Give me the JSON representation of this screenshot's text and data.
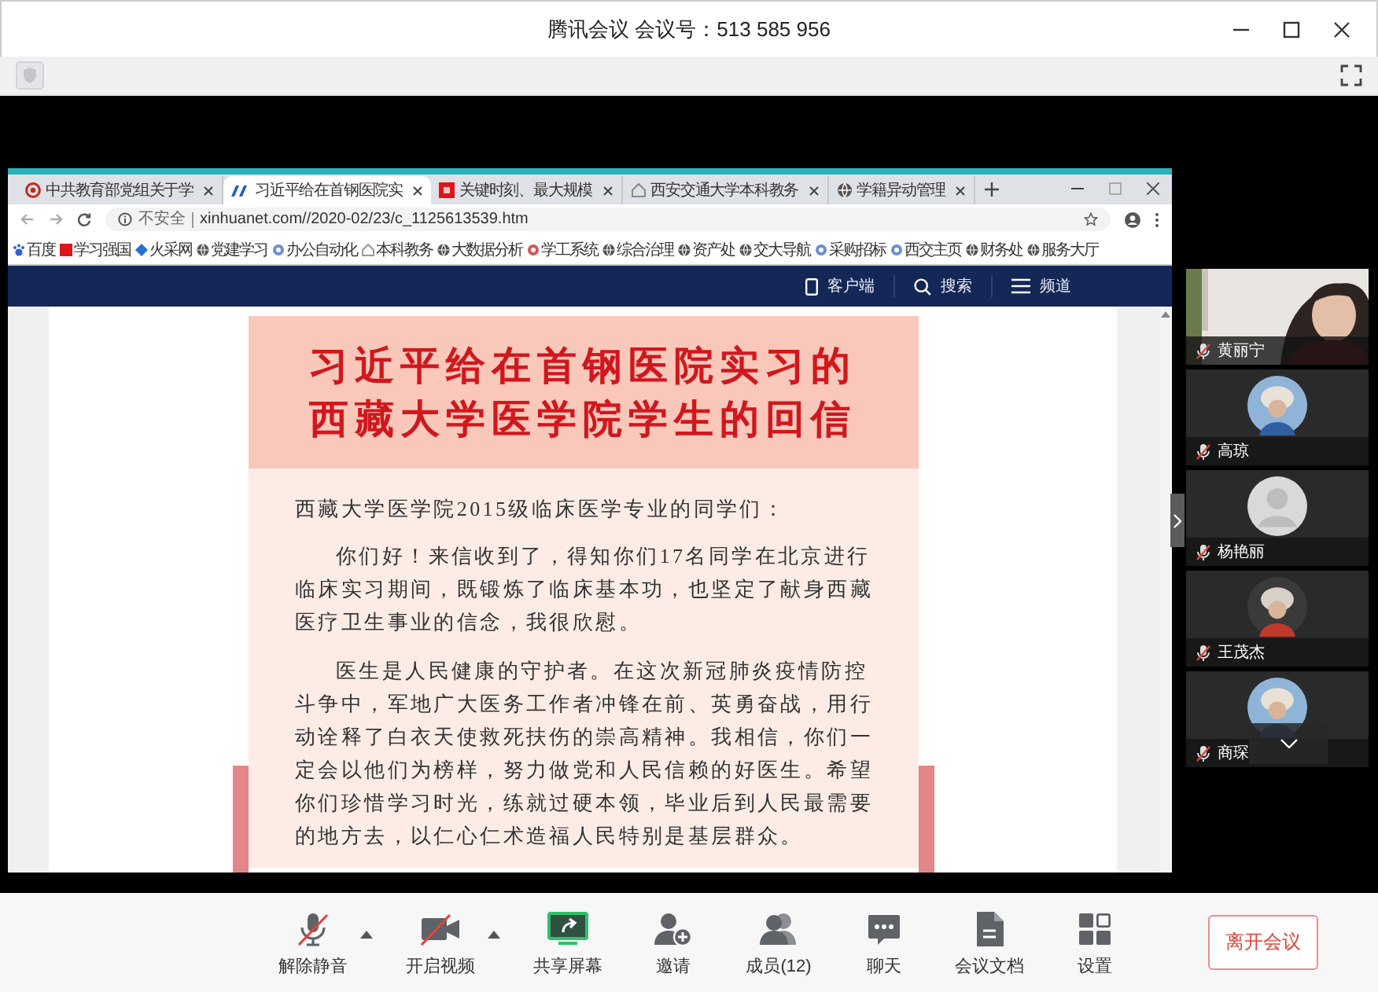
{
  "window": {
    "title": "腾讯会议 会议号：513 585 956"
  },
  "shared_screen": {
    "browser": {
      "tabs": [
        {
          "title": "中共教育部党组关于学",
          "selected": false
        },
        {
          "title": "习近平给在首钢医院实",
          "selected": true
        },
        {
          "title": "关键时刻、最大规模",
          "selected": false
        },
        {
          "title": "西安交通大学本科教务",
          "selected": false
        },
        {
          "title": "学籍异动管理",
          "selected": false
        }
      ],
      "security": "不安全",
      "url": "xinhuanet.com//2020-02/23/c_1125613539.htm",
      "bookmarks": [
        "百度",
        "学习强国",
        "火采网",
        "党建学习",
        "办公自动化",
        "本科教务",
        "大数据分析",
        "学工系统",
        "综合治理",
        "资产处",
        "交大导航",
        "采购招标",
        "西交主页",
        "财务处",
        "服务大厅"
      ]
    },
    "site_nav": [
      "客户端",
      "搜索",
      "频道"
    ],
    "article": {
      "title": "习近平给在首钢医院实习的西藏大学医学院学生的回信",
      "salutation": "西藏大学医学院2015级临床医学专业的同学们：",
      "paragraphs": [
        "你们好！来信收到了，得知你们17名同学在北京进行临床实习期间，既锻炼了临床基本功，也坚定了献身西藏医疗卫生事业的信念，我很欣慰。",
        "医生是人民健康的守护者。在这次新冠肺炎疫情防控斗争中，军地广大医务工作者冲锋在前、英勇奋战，用行动诠释了白衣天使救死扶伤的崇高精神。我相信，你们一定会以他们为榜样，努力做党和人民信赖的好医生。希望你们珍惜学习时光，练就过硬本领，毕业后到人民最需要的地方去，以仁心仁术造福人民特别是基层群众。"
      ]
    }
  },
  "participants": [
    {
      "name": "黄丽宁",
      "muted": true,
      "kind": "video"
    },
    {
      "name": "高琼",
      "muted": true
    },
    {
      "name": "杨艳丽",
      "muted": true,
      "kind": "default"
    },
    {
      "name": "王茂杰",
      "muted": true
    },
    {
      "name": "商琛",
      "muted": true
    }
  ],
  "toolbar": [
    {
      "kind": "mic",
      "label": "解除静音",
      "off": true,
      "menu": true
    },
    {
      "kind": "camera",
      "label": "开启视频",
      "off": true,
      "menu": true
    },
    {
      "kind": "share",
      "label": "共享屏幕"
    },
    {
      "kind": "invite",
      "label": "邀请"
    },
    {
      "kind": "members",
      "label": "成员(12)"
    },
    {
      "kind": "chat",
      "label": "聊天"
    },
    {
      "kind": "docs",
      "label": "会议文档"
    },
    {
      "kind": "settings",
      "label": "设置"
    }
  ],
  "leave_button": "离开会议"
}
